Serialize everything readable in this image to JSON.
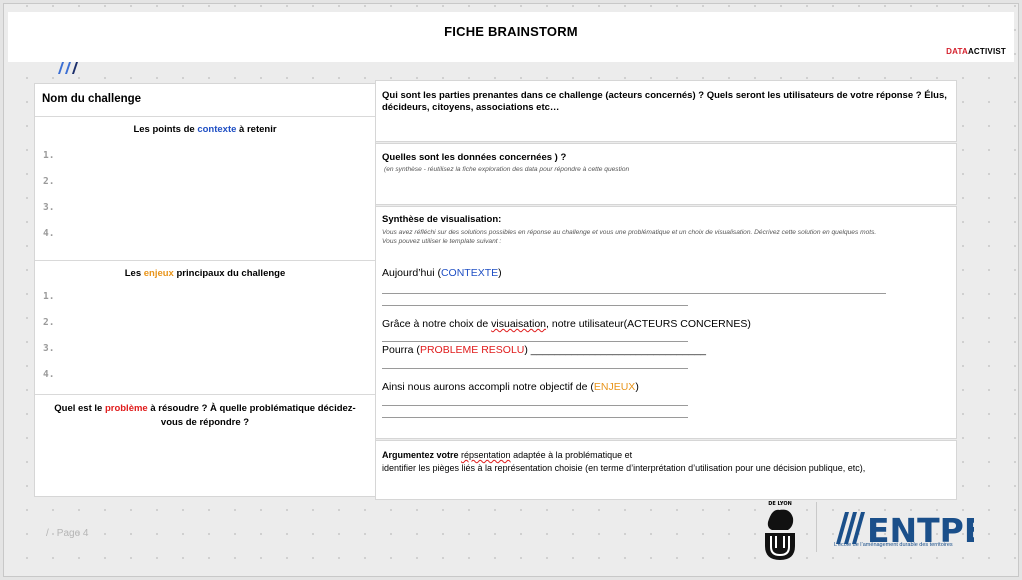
{
  "header": {
    "title": "FICHE BRAINSTORM",
    "brand_red": "DATA",
    "brand_black": "ACTIVIST"
  },
  "left": {
    "name_label": "Nom du challenge",
    "context": {
      "pre": "Les points de ",
      "keyword": "contexte",
      "post": " à retenir",
      "items": [
        "1.",
        "2.",
        "3.",
        "4."
      ]
    },
    "stakes": {
      "pre": "Les ",
      "keyword": "enjeux",
      "post": " principaux du challenge",
      "items": [
        "1.",
        "2.",
        "3.",
        "4."
      ]
    },
    "problem": {
      "pre": "Quel est le ",
      "keyword": "problème",
      "post": " à résoudre ? À quelle problématique décidez-vous de répondre ?"
    }
  },
  "right": {
    "stakeholders": "Qui sont les parties prenantes dans ce challenge (acteurs concernés) ? Quels seront les utilisateurs de votre réponse ? Élus, décideurs, citoyens, associations etc…",
    "data_question": "Quelles sont les données concernées ) ?",
    "data_hint": "(en synthèse -  réutilisez la fiche exploration des data pour répondre à cette question",
    "synthesis": {
      "title": "Synthèse de visualisation:",
      "hint1": "Vous avez réfléchi sur des solutions possibles en réponse au challenge et vous une problématique et un choix de visualisation. Décrivez cette solution en quelques mots.",
      "hint2": "Vous pouvez utiliser le template suivant :",
      "today_pre": "Aujourd’hui (",
      "today_kw": "CONTEXTE",
      "today_post": ")",
      "thanks_pre": "Grâce à notre choix de ",
      "thanks_kw": "visuaisation",
      "thanks_post": ", notre utilisateur(ACTEURS CONCERNES)",
      "could_pre": "Pourra (",
      "could_kw": "PROBLEME RESOLU",
      "could_post": ") ______________________________",
      "goal_pre": "Ainsi nous aurons accompli notre objectif de (",
      "goal_kw": "ENJEUX",
      "goal_post": ")"
    },
    "argue": {
      "pre": "Argumentez votre ",
      "kw": "répsentation",
      "post": " adaptée à la problématique et",
      "line2": "identifier les pièges liés à la représentation choisie (en terme d’interprétation d’utilisation pour une décision publique, etc),"
    }
  },
  "footer": {
    "page_label": "Page 4",
    "uni_label": "DE LYON",
    "entpe_label": "ENTPE",
    "entpe_sub": "L’école de l’aménagement durable des territoires"
  },
  "colors": {
    "context": "#1f4fc4",
    "stakes": "#e8941a",
    "problem": "#e01b1b",
    "entpe": "#1a4f8a"
  }
}
